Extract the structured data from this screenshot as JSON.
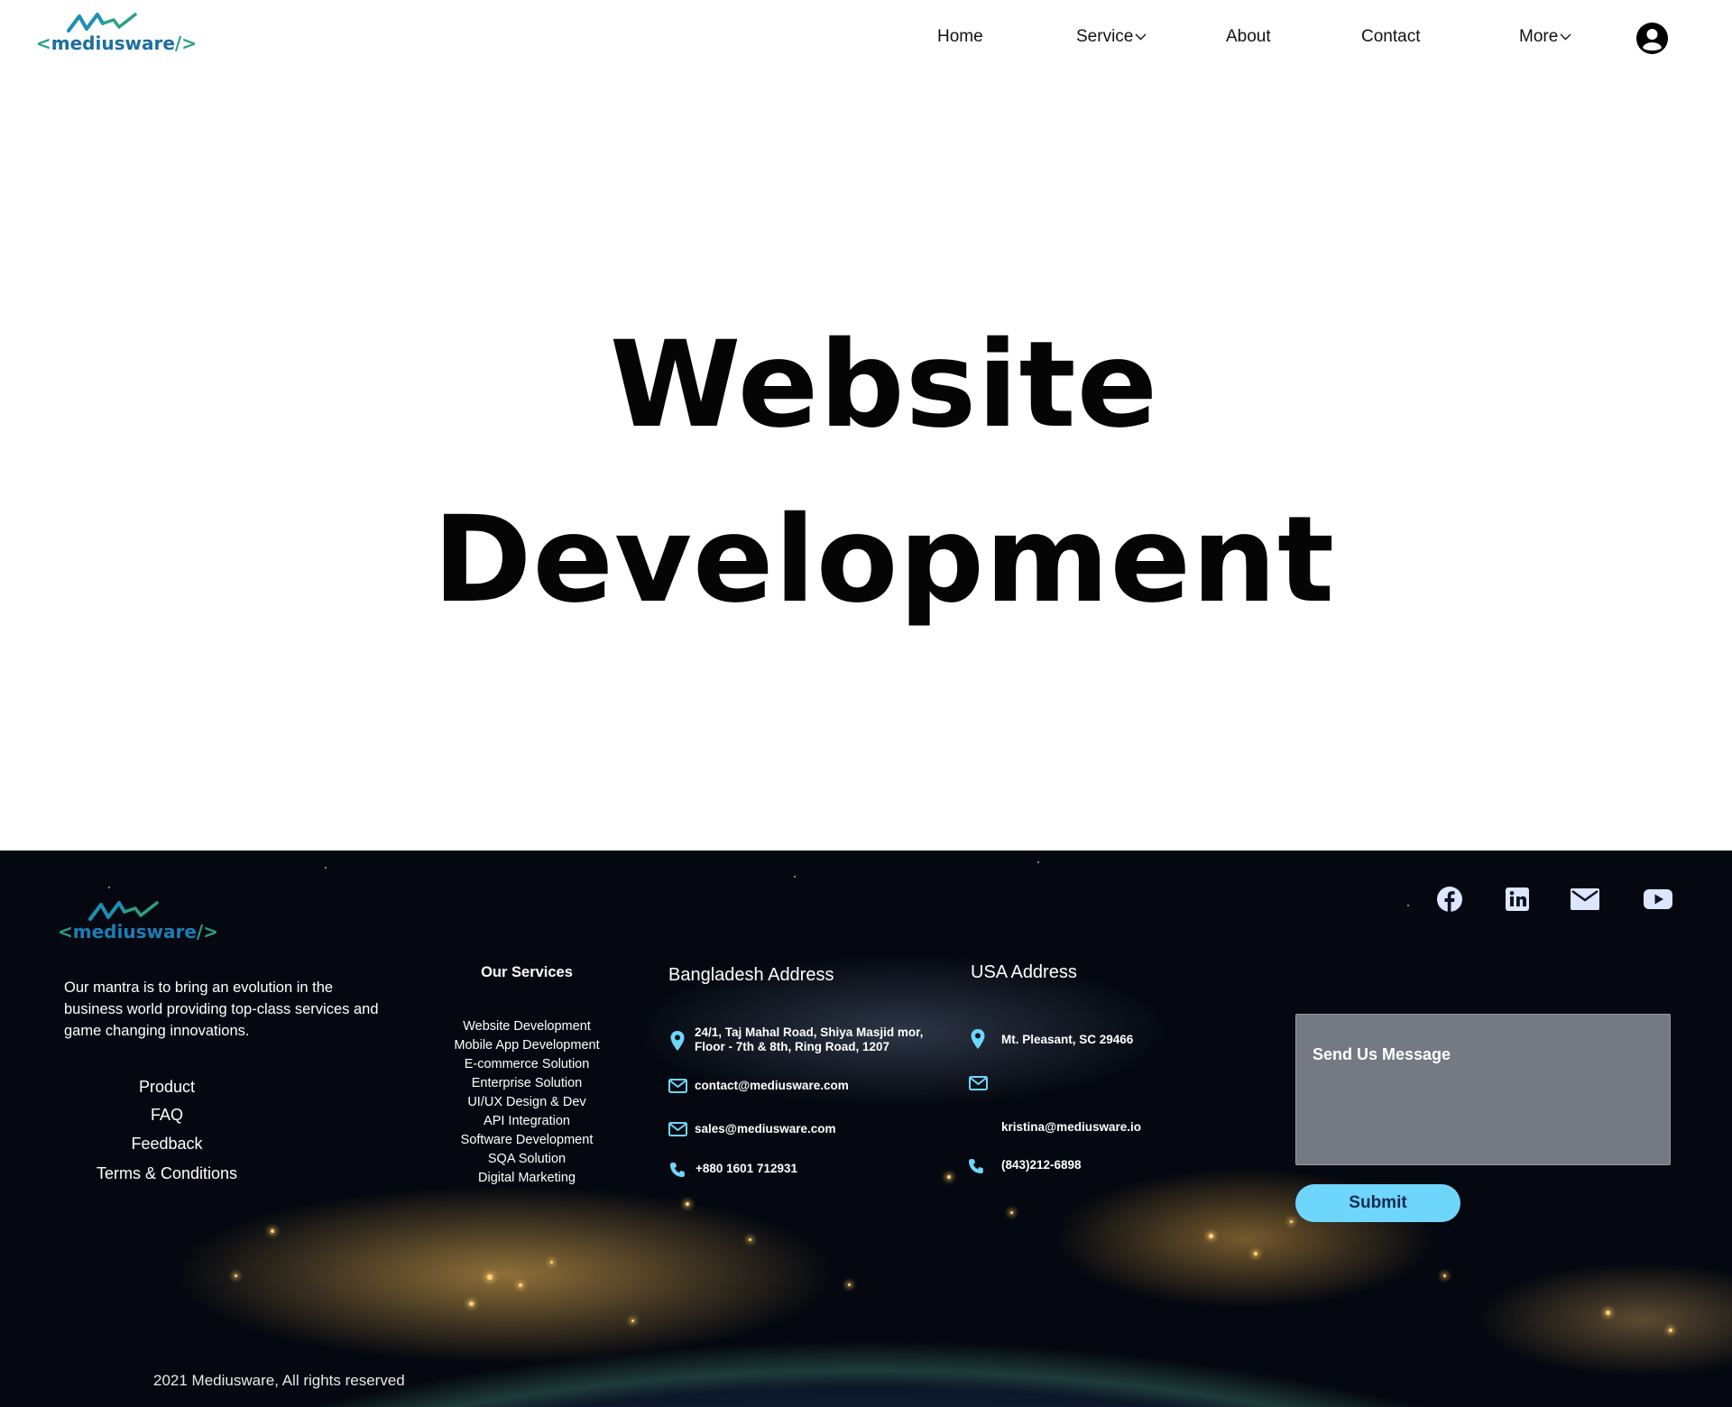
{
  "header": {
    "logo": {
      "open": "<",
      "name": "mediusware",
      "close": "/>"
    },
    "nav": {
      "home": "Home",
      "service": "Service",
      "about": "About",
      "contact": "Contact",
      "more": "More"
    }
  },
  "hero": {
    "line1": "Website",
    "line2": "Development"
  },
  "footer": {
    "logo": {
      "open": "<",
      "name": "mediusware",
      "close": "/>"
    },
    "mantra": "Our mantra is to bring an evolution in the business world providing top-class services and game changing innovations.",
    "links": [
      "Product",
      "FAQ",
      "Feedback",
      "Terms & Conditions"
    ],
    "services_title": "Our Services",
    "services": [
      "Website Development",
      "Mobile App Development",
      "E-commerce Solution",
      "Enterprise Solution",
      "UI/UX Design & Dev",
      "API Integration",
      "Software Development",
      "SQA Solution",
      "Digital Marketing"
    ],
    "bd": {
      "title": "Bangladesh Address",
      "address_line1": "24/1, Taj Mahal Road, Shiya Masjid mor,",
      "address_line2": "Floor - 7th & 8th, Ring Road, 1207",
      "email1": "contact@mediusware.com",
      "email2": "sales@mediusware.com",
      "phone": "+880 1601 712931"
    },
    "usa": {
      "title": "USA Address",
      "address": "Mt. Pleasant, SC 29466",
      "email": "kristina@mediusware.io",
      "phone": "(843)212-6898"
    },
    "form": {
      "placeholder": "Send Us Message",
      "submit": "Submit"
    },
    "copyright": "2021 Mediusware, All rights reserved"
  },
  "colors": {
    "accent": "#6fd6fb",
    "logo_green": "#2aa08a",
    "logo_blue": "#1a6fa0",
    "submit_text": "#0f2a52"
  }
}
